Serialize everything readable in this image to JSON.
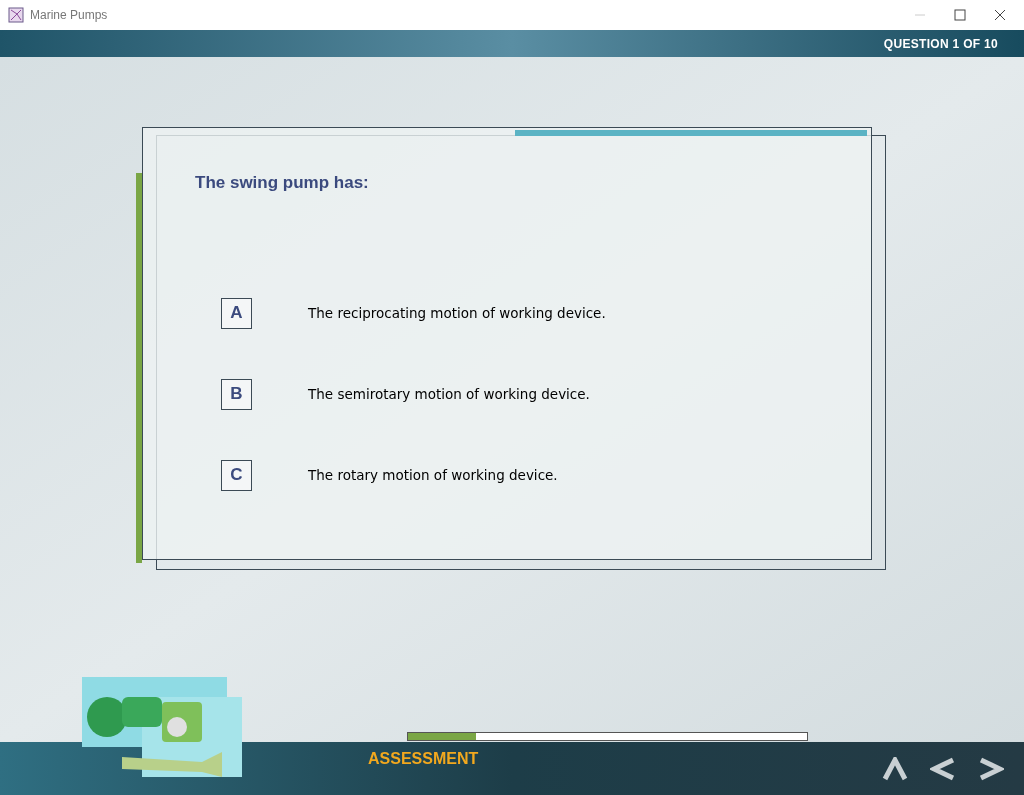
{
  "window": {
    "title": "Marine Pumps"
  },
  "header": {
    "counter": "QUESTION 1 OF 10"
  },
  "question": {
    "text": "The swing pump has:",
    "options": [
      {
        "letter": "A",
        "text": "The reciprocating motion of working device."
      },
      {
        "letter": "B",
        "text": "The semirotary motion of working device."
      },
      {
        "letter": "C",
        "text": "The rotary motion of working device."
      }
    ]
  },
  "progress": {
    "level": 0.17
  },
  "footer": {
    "section": "ASSESSMENT"
  }
}
